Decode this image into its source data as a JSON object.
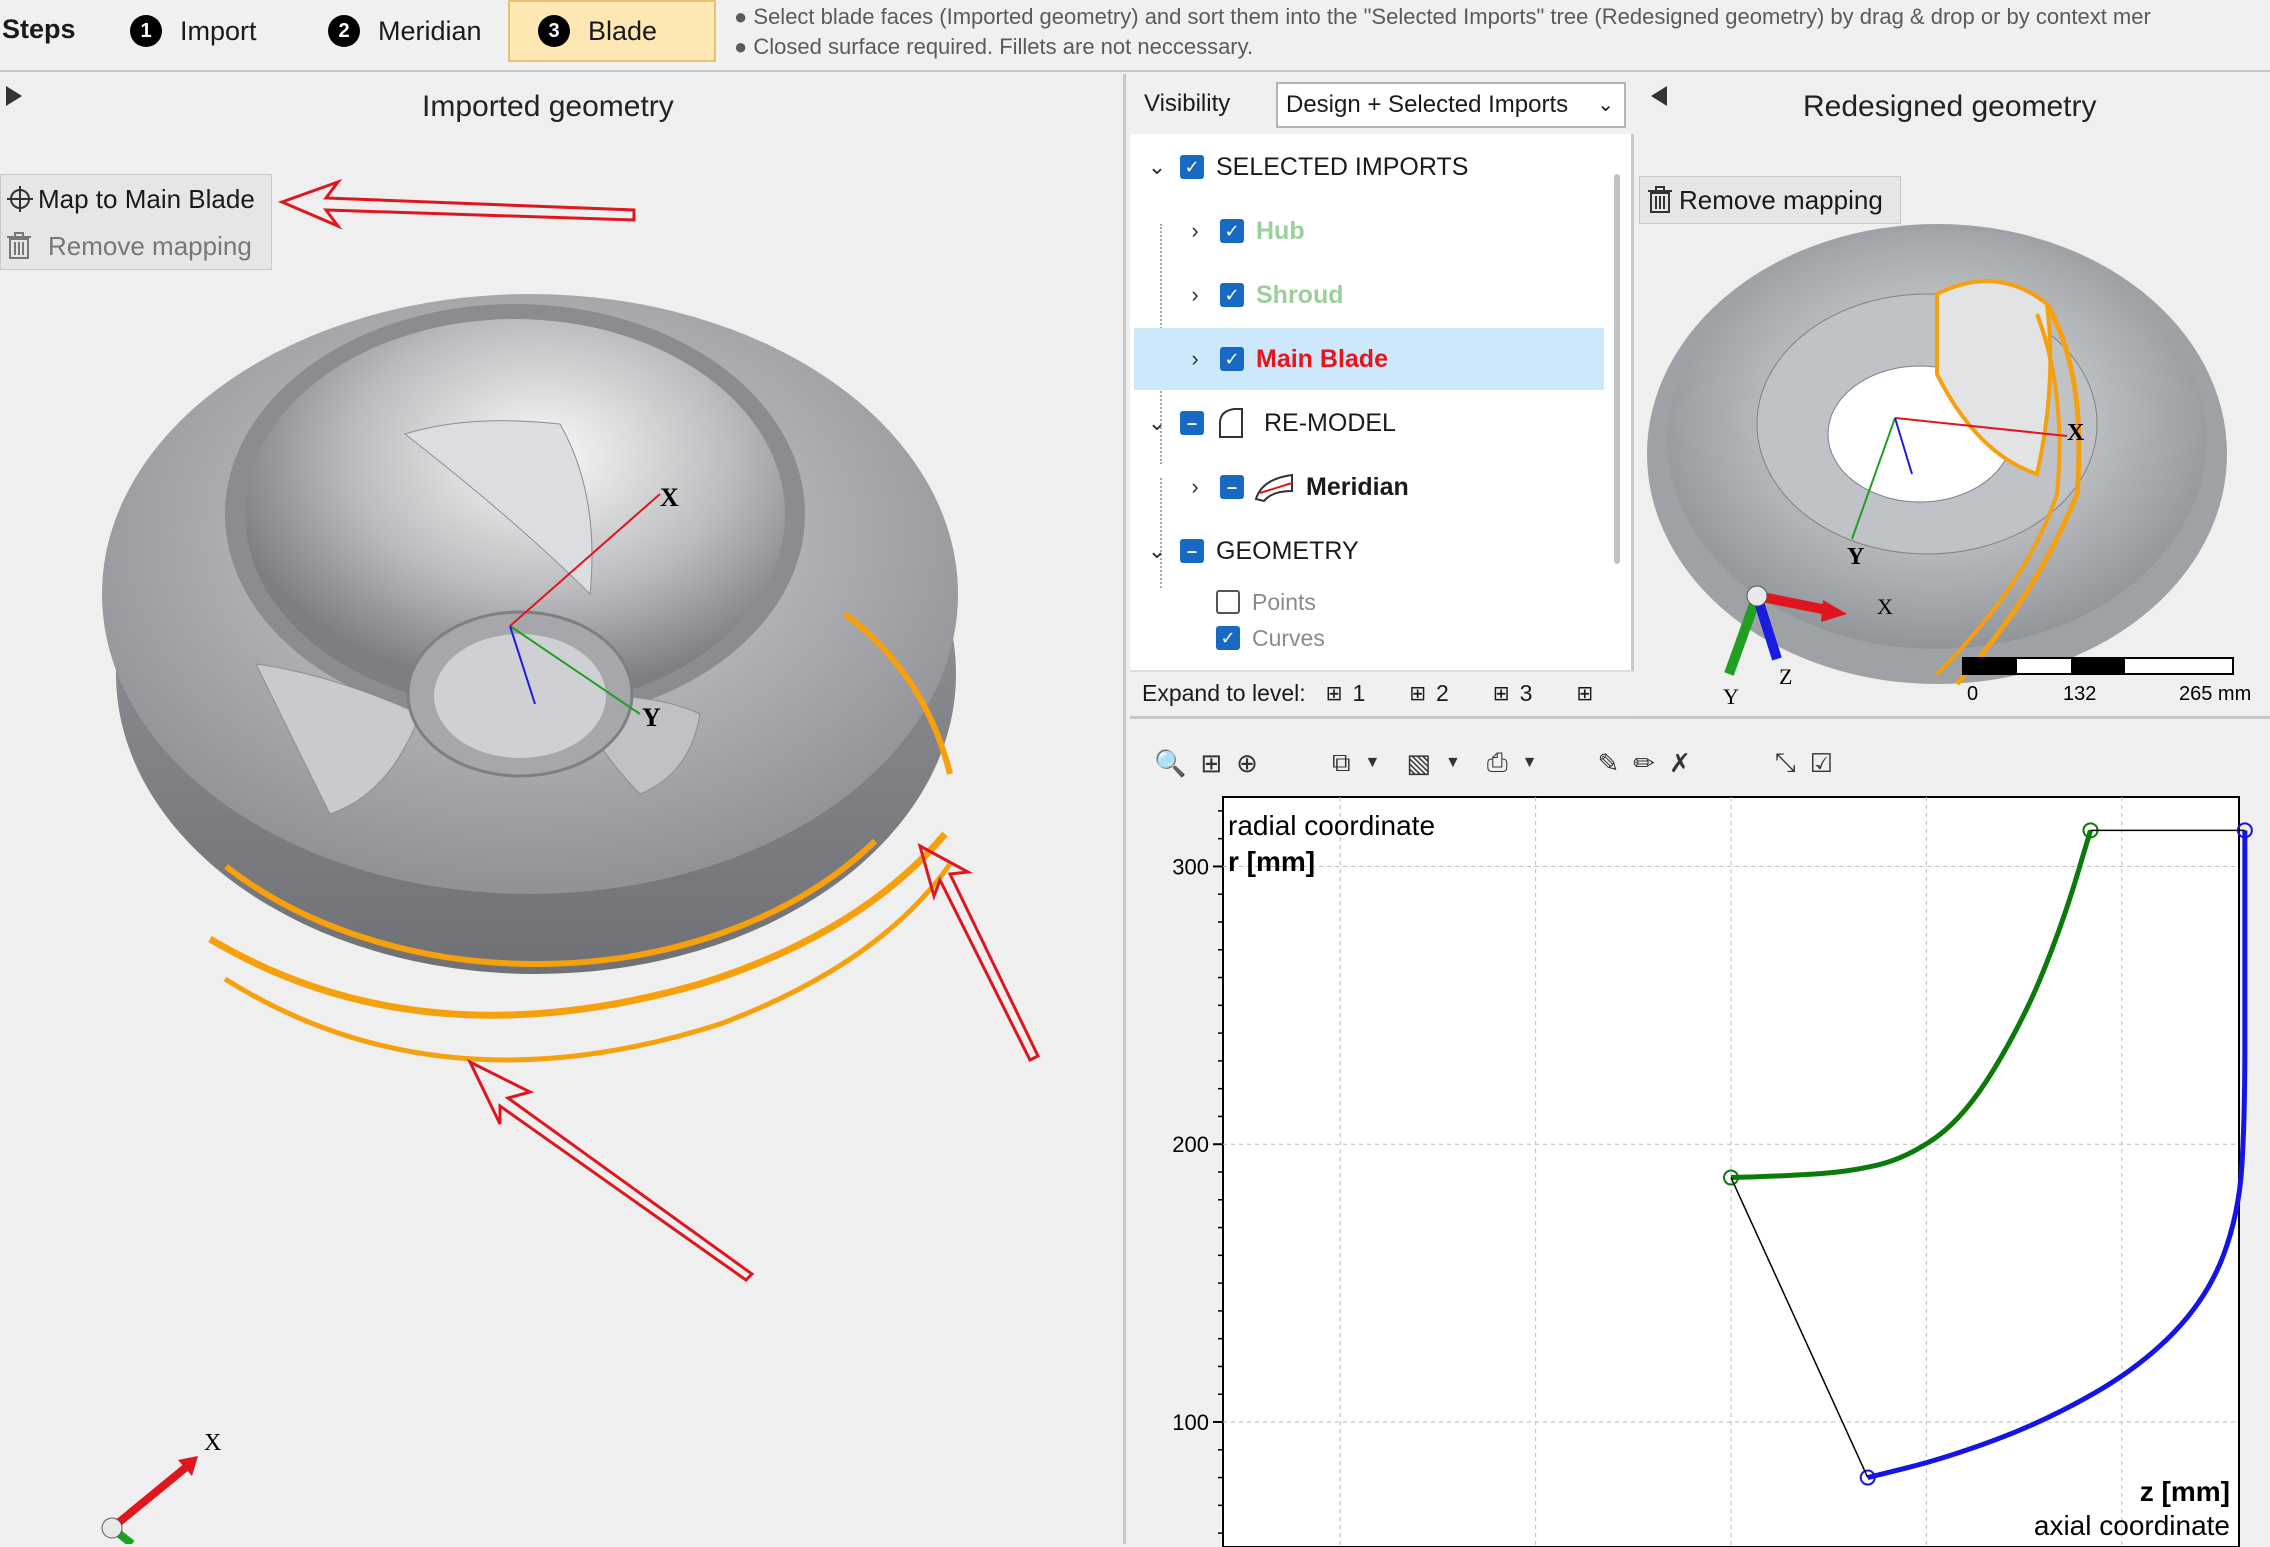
{
  "steps": {
    "label": "Steps",
    "items": [
      {
        "num": "1",
        "label": "Import"
      },
      {
        "num": "2",
        "label": "Meridian"
      },
      {
        "num": "3",
        "label": "Blade"
      }
    ],
    "active": "Blade",
    "hint_line1": "● Select blade faces (Imported geometry) and sort them into the \"Selected Imports\" tree (Redesigned geometry) by drag & drop or by context mer",
    "hint_line2": "● Closed surface required. Fillets are not neccessary."
  },
  "left": {
    "title": "Imported geometry",
    "map_button": "Map to Main Blade",
    "remove_button": "Remove mapping",
    "axis_x": "X",
    "axis_y": "Y",
    "triad_x": "X"
  },
  "tree": {
    "visibility_label": "Visibility",
    "visibility_value": "Design + Selected Imports",
    "items": [
      {
        "label": "SELECTED IMPORTS"
      },
      {
        "label": "Hub"
      },
      {
        "label": "Shroud"
      },
      {
        "label": "Main Blade"
      },
      {
        "label": "RE-MODEL"
      },
      {
        "label": "Meridian"
      },
      {
        "label": "GEOMETRY"
      },
      {
        "label": "Points"
      },
      {
        "label": "Curves"
      }
    ],
    "expand_label": "Expand to level:",
    "levels": [
      "1",
      "2",
      "3"
    ],
    "colors": {
      "selected_bg": "#cde8fb",
      "hub_shroud": "#9ccf9c",
      "main_blade": "#e8141c",
      "checkbox": "#1769c4"
    }
  },
  "right": {
    "title": "Redesigned geometry",
    "remove_button": "Remove mapping",
    "axis_x": "X",
    "axis_y": "Y",
    "triad_x": "X",
    "triad_y": "Y",
    "triad_z": "Z",
    "scale_labels": [
      "0",
      "132",
      "265 mm"
    ]
  },
  "chart_data": {
    "type": "line",
    "title": "",
    "ylabel_top": "radial coordinate",
    "ylabel": "r [mm]",
    "xlabel": "z [mm]",
    "xlabel_bottom": "axial coordinate",
    "y_ticks": [
      100,
      200,
      300
    ],
    "ylim": [
      55,
      325
    ],
    "grid": true,
    "series": [
      {
        "color": "#0a7a0a",
        "values": [
          [
            0,
            188
          ],
          [
            12,
            188.5
          ],
          [
            30,
            190
          ],
          [
            45,
            195
          ],
          [
            60,
            210
          ],
          [
            75,
            245
          ],
          [
            85,
            280
          ],
          [
            92,
            313
          ]
        ]
      },
      {
        "color": "#1414e6",
        "values": [
          [
            35,
            80
          ],
          [
            55,
            87
          ],
          [
            80,
            100
          ],
          [
            105,
            120
          ],
          [
            122,
            145
          ],
          [
            130,
            175
          ],
          [
            131.5,
            210
          ],
          [
            131.5,
            260
          ],
          [
            131.5,
            313
          ]
        ]
      },
      {
        "color": "#000000",
        "values": [
          [
            0,
            188
          ],
          [
            35,
            80
          ]
        ]
      },
      {
        "color": "#000000",
        "values": [
          [
            92,
            313
          ],
          [
            131.5,
            313
          ]
        ]
      }
    ],
    "xlim": [
      -130,
      130
    ]
  },
  "colors": {
    "accent": "#fde7b3",
    "orange": "#f5a00c",
    "arrow_red": "#e0161e"
  }
}
